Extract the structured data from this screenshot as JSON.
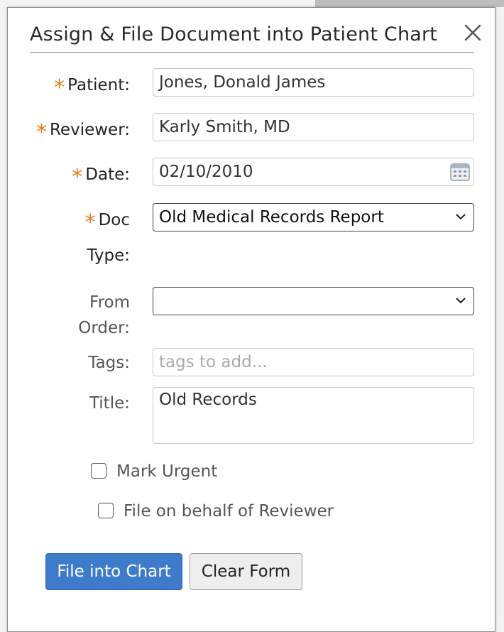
{
  "dialog": {
    "title": "Assign & File Document into Patient Chart"
  },
  "form": {
    "patient": {
      "label": "Patient:",
      "value": "Jones, Donald James"
    },
    "reviewer": {
      "label": "Reviewer:",
      "value": "Karly Smith, MD"
    },
    "date": {
      "label": "Date:",
      "value": "02/10/2010"
    },
    "doc_type": {
      "label_line1": "Doc",
      "label_line2": "Type:",
      "value": "Old Medical Records Report"
    },
    "from_order": {
      "label_line1": "From",
      "label_line2": "Order:",
      "value": ""
    },
    "tags": {
      "label": "Tags:",
      "placeholder": "tags to add..."
    },
    "title": {
      "label": "Title:",
      "value": "Old Records"
    },
    "required_marker": "*",
    "mark_urgent": {
      "label": "Mark Urgent",
      "checked": false
    },
    "file_on_behalf": {
      "label": "File on behalf of Reviewer",
      "checked": false
    }
  },
  "actions": {
    "file_label": "File into Chart",
    "clear_label": "Clear Form"
  },
  "colors": {
    "required_asterisk": "#e47f23",
    "primary_button": "#3e7ccb"
  },
  "icons": {
    "close": "close-icon",
    "calendar": "calendar-icon",
    "dropdown": "chevron-down-icon"
  }
}
